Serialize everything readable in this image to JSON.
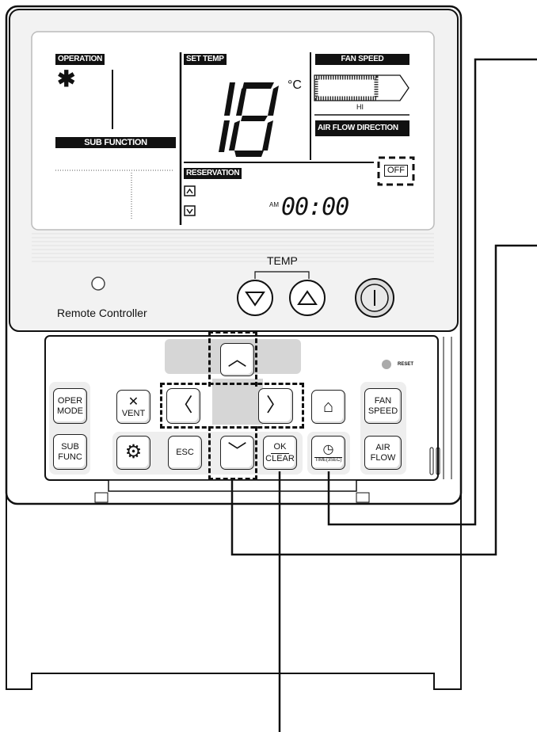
{
  "lcd": {
    "operation_label": "OPERATION",
    "sub_function_label": "SUB FUNCTION",
    "set_temp_label": "SET TEMP",
    "temperature_value": "18",
    "temperature_unit": "°C",
    "fan_speed_label": "FAN SPEED",
    "fan_speed_value": "HI",
    "air_flow_direction_label": "AIR FLOW DIRECTION",
    "reservation_label": "RESERVATION",
    "off_indicator": "OFF",
    "am_label": "AM",
    "time_value": "00:00",
    "operation_icon": "snowflake-icon"
  },
  "upper_panel": {
    "temp_label": "TEMP",
    "remote_controller_label": "Remote Controller"
  },
  "buttons": {
    "oper_mode": [
      "OPER",
      "MODE"
    ],
    "sub_func": [
      "SUB",
      "FUNC"
    ],
    "vent": "VENT",
    "esc": "ESC",
    "ok": "OK",
    "clear": "CLEAR",
    "time": "TIME(3SEC)",
    "fan_speed": [
      "FAN",
      "SPEED"
    ],
    "air_flow": [
      "AIR",
      "FLOW"
    ],
    "reset": "RESET"
  }
}
